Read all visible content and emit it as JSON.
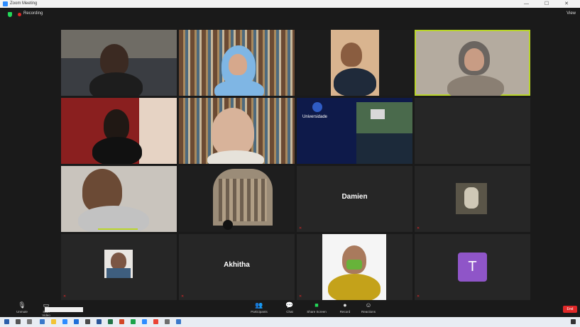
{
  "window": {
    "title": "Zoom Meeting",
    "controls": "—  ☐  ✕"
  },
  "topbar": {
    "recording_label": "Recording",
    "view_label": "View"
  },
  "tiles": [
    {
      "name": "",
      "muted": false
    },
    {
      "name": "",
      "muted": false
    },
    {
      "name": "",
      "muted": false
    },
    {
      "name": "",
      "muted": false
    },
    {
      "name": "",
      "muted": false
    },
    {
      "name": "",
      "muted": false
    },
    {
      "name": "",
      "muted": false
    },
    {
      "name": "",
      "muted": false
    },
    {
      "name": "",
      "muted": false
    },
    {
      "name": "",
      "muted": false
    },
    {
      "name": "Damien",
      "muted": true
    },
    {
      "name": "",
      "muted": true
    },
    {
      "name": "",
      "muted": true
    },
    {
      "name": "Akhitha",
      "muted": true
    },
    {
      "name": "",
      "muted": true
    },
    {
      "name": "T",
      "muted": true
    }
  ],
  "slide": {
    "logo_text": "Universidade"
  },
  "toolbar": {
    "mute": "Unmute",
    "video": "Start Video",
    "participants": "Participants",
    "participants_count": "21",
    "chat": "Chat",
    "share": "Share Screen",
    "record": "Record",
    "reactions": "Reactions",
    "end": "End",
    "tooltip": ""
  },
  "taskbar": {
    "time": "",
    "date": ""
  },
  "colors": {
    "active_speaker": "#b9d52a",
    "share_green": "#23d959",
    "end_red": "#e02828",
    "avatar_purple": "#8f55c8"
  }
}
